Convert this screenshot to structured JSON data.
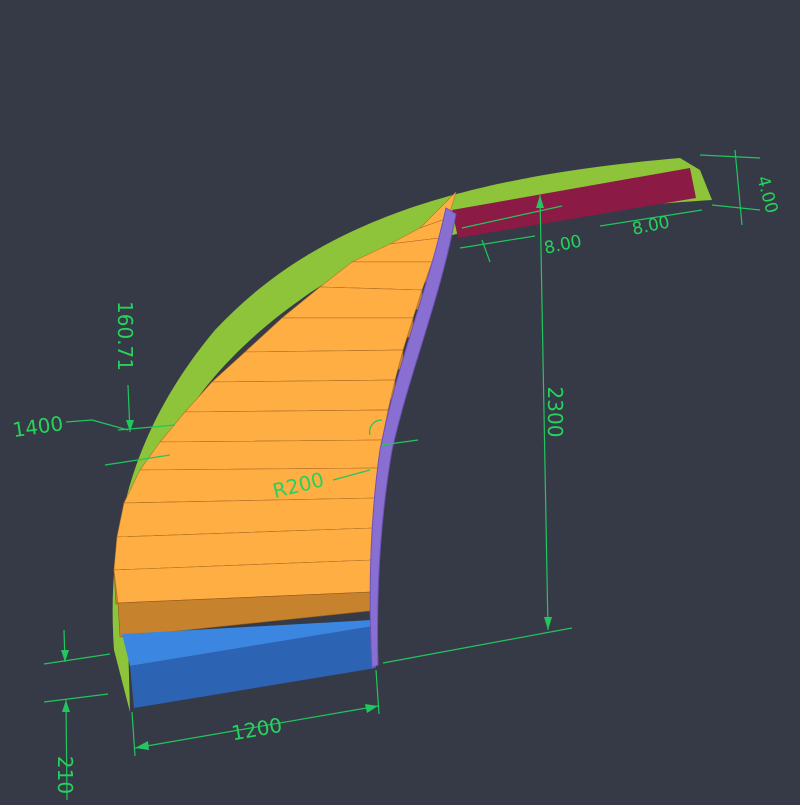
{
  "drawing": {
    "background": "#363a47",
    "colors": {
      "stringer_outer": "#8ec43a",
      "stringer_outer_dark": "#7fb234",
      "tread_top": "#ffae44",
      "tread_riser": "#c6822c",
      "tread_top_shade": "#f4a23e",
      "first_step_top": "#3b86e0",
      "first_step_front": "#2c63b3",
      "top_landing": "#8b1a45",
      "inner_stringer": "#8a6fd2",
      "inner_stringer_edge": "#6d53b8",
      "dimension_line": "#22c55e"
    },
    "step_count": 14
  },
  "dimensions": {
    "total_height": "2300",
    "width_base": "1200",
    "step_rise": "160.71",
    "outer_width": "1400",
    "inner_radius": "R200",
    "bottom_offset": "210",
    "top_thickness": "4.00",
    "top_offset_a": "8.00",
    "top_offset_b": "8.00"
  }
}
